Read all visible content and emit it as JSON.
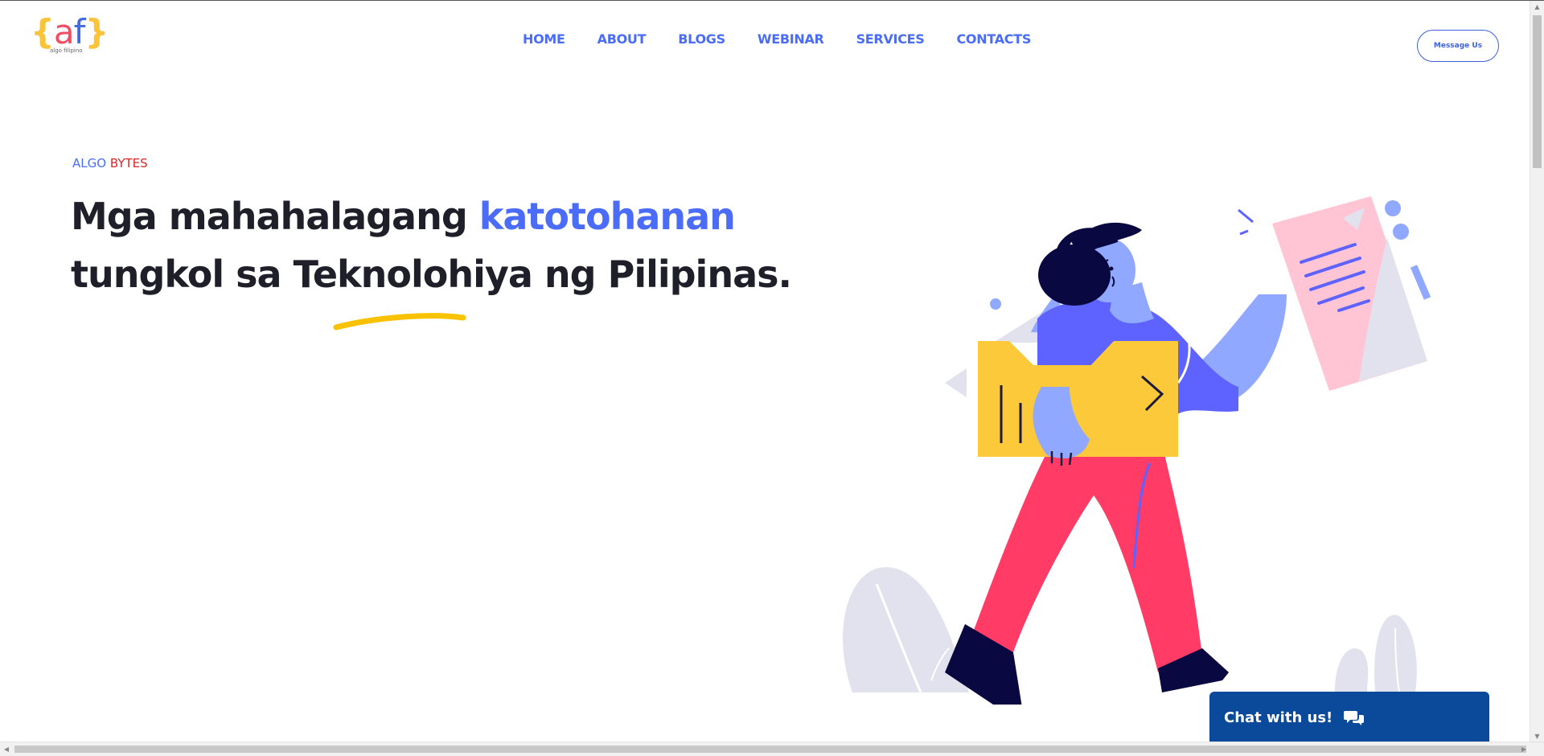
{
  "logo": {
    "open_brace": "{",
    "a": "a",
    "f": "f",
    "close_brace": "}",
    "subtitle": "algo filipino"
  },
  "nav": {
    "items": [
      {
        "label": "HOME"
      },
      {
        "label": "ABOUT"
      },
      {
        "label": "BLOGS"
      },
      {
        "label": "WEBINAR"
      },
      {
        "label": "SERVICES"
      },
      {
        "label": "CONTACTS"
      }
    ]
  },
  "header": {
    "message_button": "Message Us"
  },
  "hero": {
    "eyebrow_part1": "ALGO",
    "eyebrow_part2": "BYTES",
    "headline_part1": "Mga mahahalagang ",
    "headline_highlight": "katotohanan",
    "headline_part2": "tungkol sa Teknolohiya ng Pilipinas."
  },
  "chat": {
    "label": "Chat with us!",
    "icon": "chat-bubbles-icon"
  },
  "colors": {
    "accent_blue": "#4a6cf7",
    "accent_red": "#d62828",
    "chat_bg": "#0b4a9a",
    "illus_yellow": "#fcc93a",
    "illus_pink": "#ff3b66",
    "illus_purple": "#5e62ff"
  }
}
